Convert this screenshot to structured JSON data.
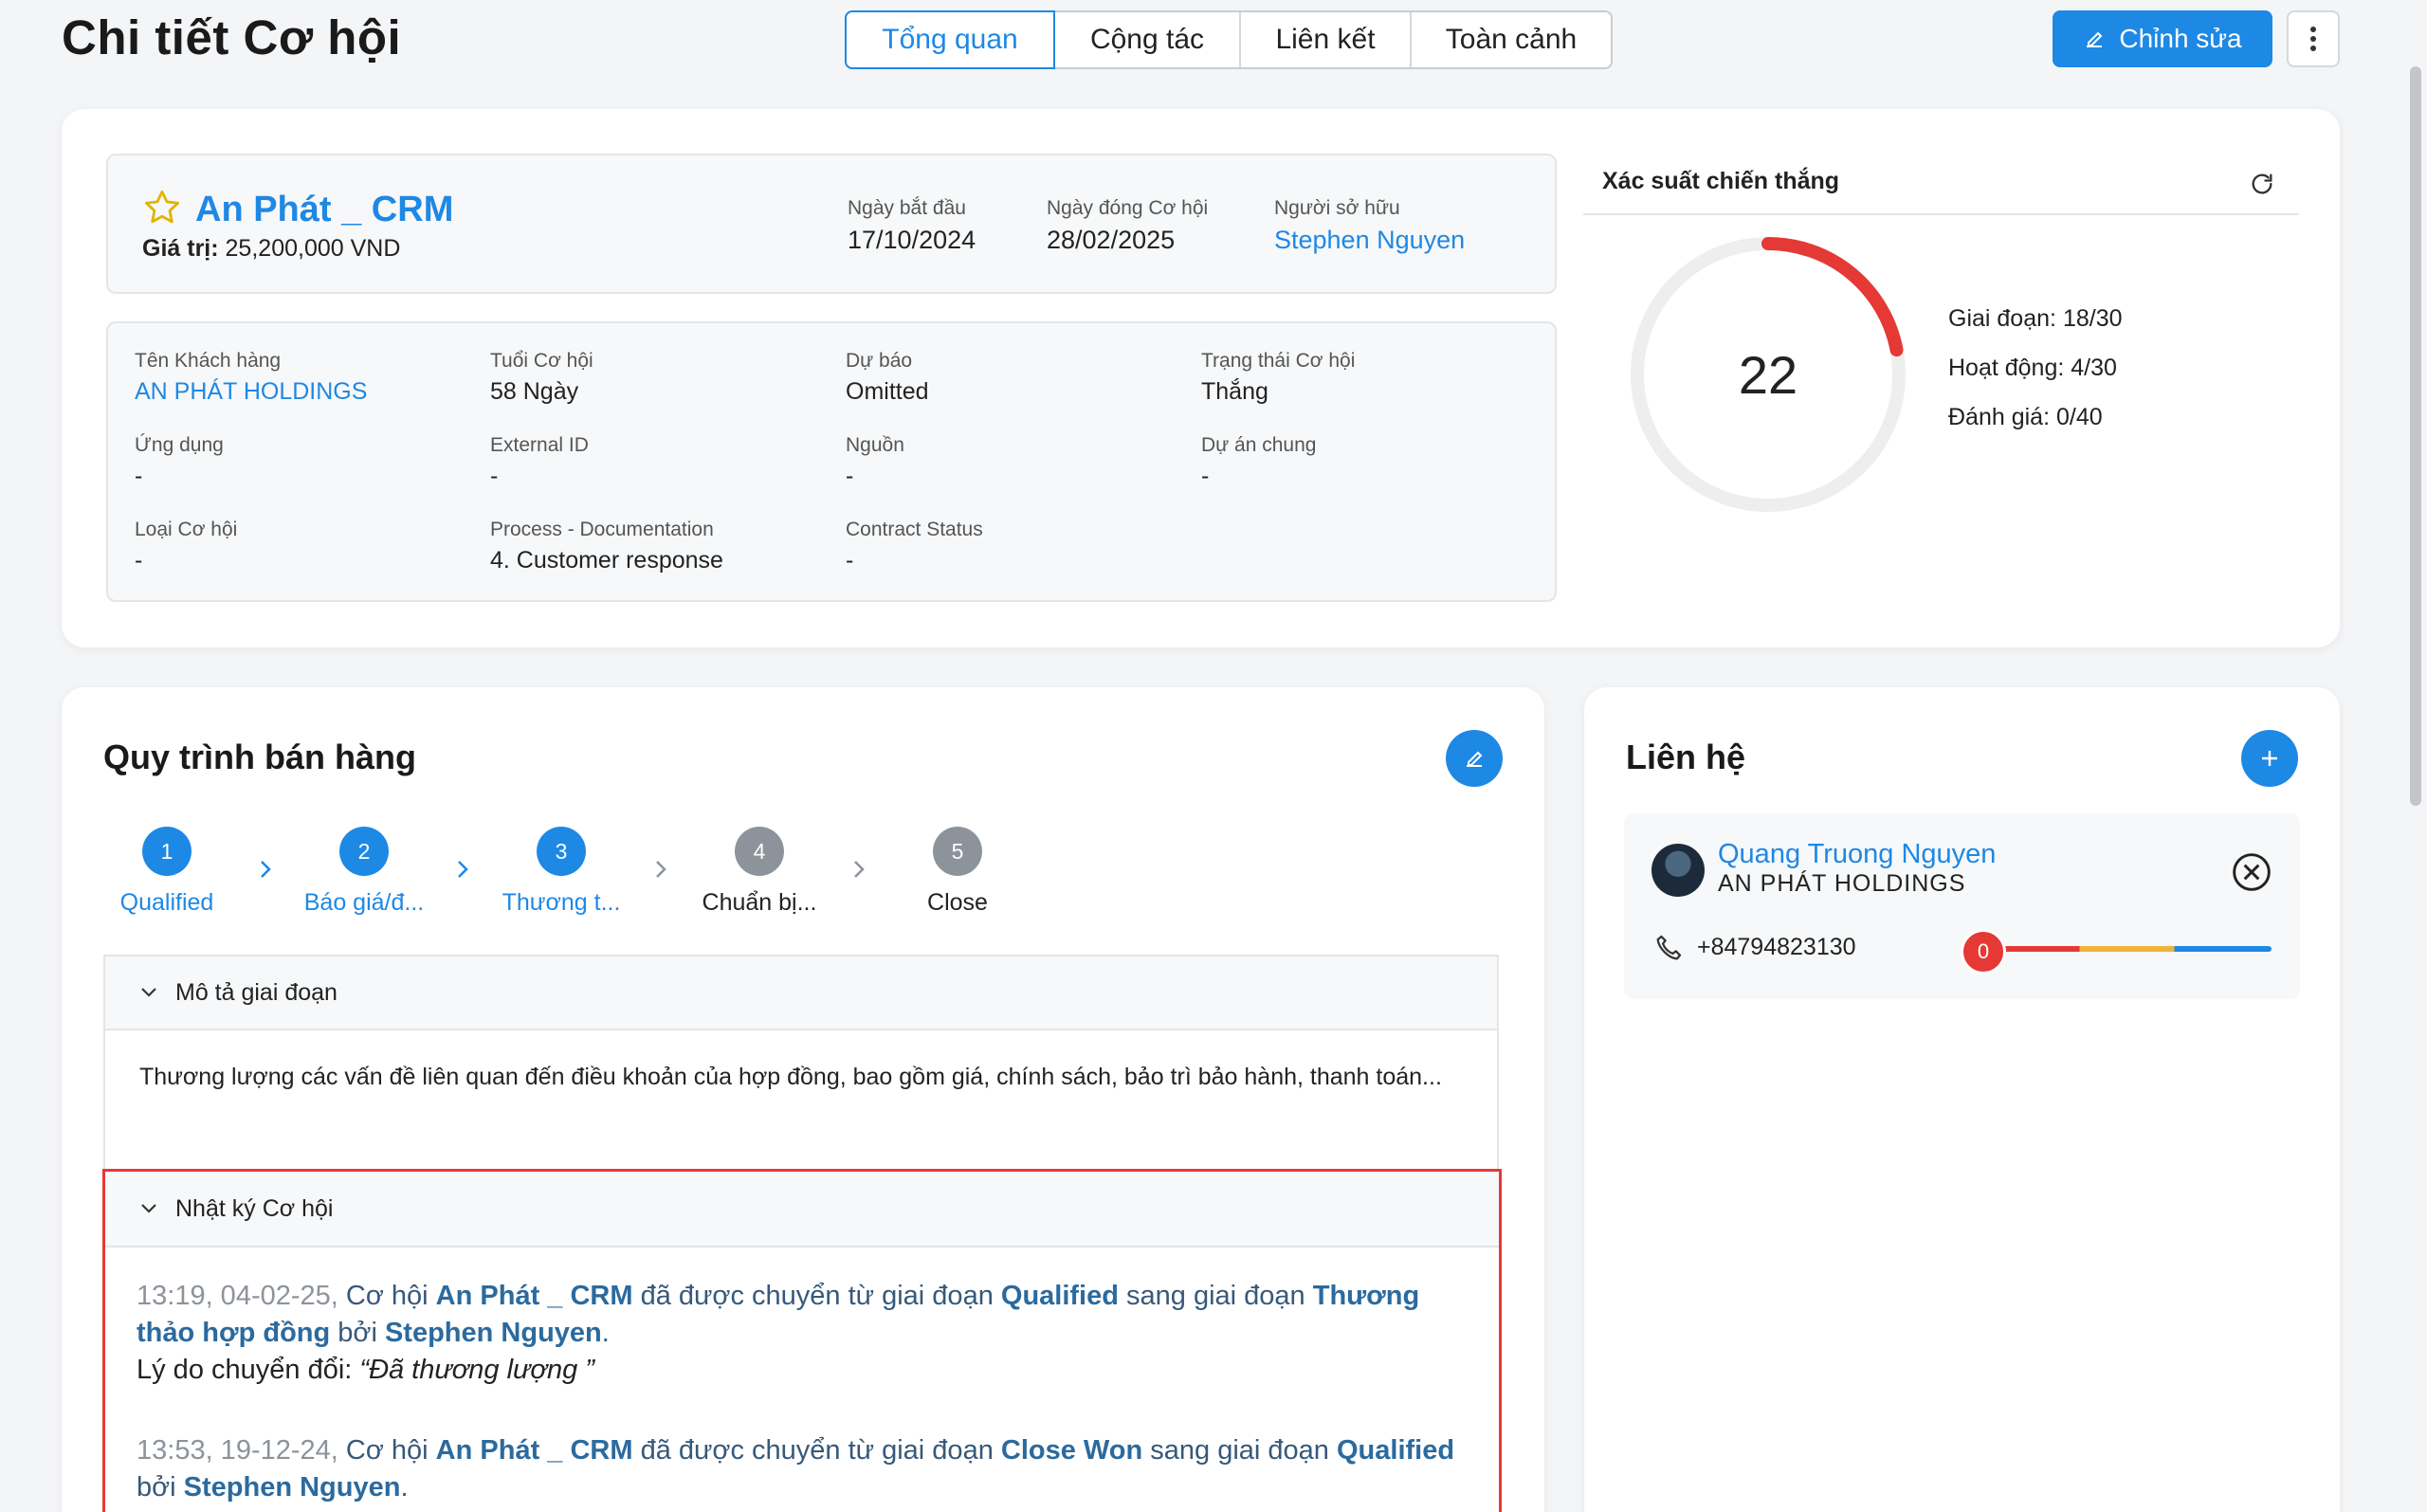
{
  "page_title": "Chi tiết Cơ hội",
  "tabs": [
    {
      "label": "Tổng quan",
      "active": true
    },
    {
      "label": "Cộng tác",
      "active": false
    },
    {
      "label": "Liên kết",
      "active": false
    },
    {
      "label": "Toàn cảnh",
      "active": false
    }
  ],
  "header_actions": {
    "edit_label": "Chỉnh sửa",
    "more_icon": "kebab-icon"
  },
  "opportunity": {
    "name": "An Phát _ CRM",
    "value_label": "Giá trị:",
    "value": "25,200,000 VND",
    "start_date_label": "Ngày bắt đầu",
    "start_date": "17/10/2024",
    "close_date_label": "Ngày đóng Cơ hội",
    "close_date": "28/02/2025",
    "owner_label": "Người sở hữu",
    "owner": "Stephen Nguyen"
  },
  "details": [
    {
      "label": "Tên Khách hàng",
      "value": "AN PHÁT HOLDINGS",
      "link": true
    },
    {
      "label": "Tuổi Cơ hội",
      "value": "58 Ngày"
    },
    {
      "label": "Dự báo",
      "value": "Omitted"
    },
    {
      "label": "Trạng thái Cơ hội",
      "value": "Thắng"
    },
    {
      "label": "Ứng dụng",
      "value": "-"
    },
    {
      "label": "External ID",
      "value": "-"
    },
    {
      "label": "Nguồn",
      "value": "-"
    },
    {
      "label": "Dự án chung",
      "value": "-"
    },
    {
      "label": "Loại Cơ hội",
      "value": "-"
    },
    {
      "label": "Process - Documentation",
      "value": "4. Customer response"
    },
    {
      "label": "Contract Status",
      "value": "-"
    }
  ],
  "win_probability": {
    "title": "Xác suất chiến thắng",
    "score": "22",
    "fraction": 0.22,
    "stats": [
      {
        "label": "Giai đoạn",
        "value": "18/30"
      },
      {
        "label": "Hoạt động",
        "value": "4/30"
      },
      {
        "label": "Đánh giá",
        "value": "0/40"
      }
    ],
    "colors": {
      "arc": "#e53935",
      "track": "#eeeeee"
    }
  },
  "sales_process": {
    "title": "Quy trình bán hàng",
    "steps": [
      {
        "num": "1",
        "label": "Qualified",
        "done": true
      },
      {
        "num": "2",
        "label": "Báo giá/đ...",
        "done": true
      },
      {
        "num": "3",
        "label": "Thương t...",
        "done": true
      },
      {
        "num": "4",
        "label": "Chuẩn bị...",
        "done": false
      },
      {
        "num": "5",
        "label": "Close",
        "done": false
      }
    ],
    "stage_desc_title": "Mô tả giai đoạn",
    "stage_desc": "Thương lượng các vấn đề liên quan đến điều khoản của hợp đồng, bao gồm giá, chính sách, bảo trì bảo hành, thanh toán...",
    "log_title": "Nhật ký Cơ hội",
    "log": [
      {
        "time": "13:19, 04-02-25,",
        "t1": "Cơ hội",
        "opp": "An Phát _ CRM",
        "t2": "đã được chuyển từ giai đoạn",
        "from": "Qualified",
        "t3": "sang giai đoạn",
        "to": "Thương thảo hợp đồng",
        "t4": "bởi",
        "by": "Stephen Nguyen",
        "reason_label": "Lý do chuyển đổi:",
        "reason": "“Đã thương lượng ”"
      },
      {
        "time": "13:53, 19-12-24,",
        "t1": "Cơ hội",
        "opp": "An Phát _ CRM",
        "t2": "đã được chuyển từ giai đoạn",
        "from": "Close Won",
        "t3": "sang giai đoạn",
        "to": "Qualified",
        "t4": "bởi",
        "by": "Stephen Nguyen"
      }
    ]
  },
  "contacts": {
    "title": "Liên hệ",
    "items": [
      {
        "name": "Quang Truong Nguyen",
        "company": "AN PHÁT HOLDINGS",
        "phone": "+84794823130",
        "score": "0",
        "score_fraction": 0
      }
    ]
  },
  "colors": {
    "accent": "#1e88e5",
    "danger": "#e53935"
  }
}
